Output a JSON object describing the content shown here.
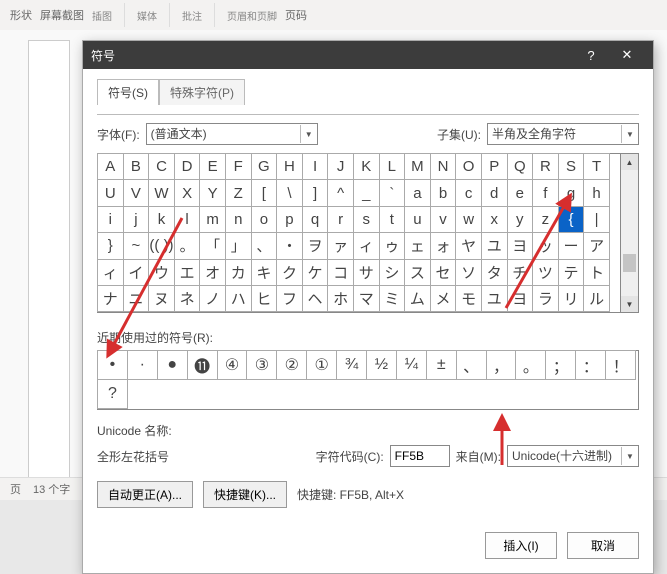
{
  "ribbon": {
    "shapes": "形状",
    "screenshot": "屏幕截图",
    "media": "媒体",
    "comment": "批注",
    "header": "页眉和页脚",
    "pagenum": "页码",
    "insert_group": "插图"
  },
  "status": {
    "page": "页",
    "words": "13 个字"
  },
  "dialog": {
    "title": "符号",
    "tab_symbols": "符号(S)",
    "tab_special": "特殊字符(P)",
    "font_label": "字体(F):",
    "font_value": "(普通文本)",
    "subset_label": "子集(U):",
    "subset_value": "半角及全角字符",
    "grid": [
      [
        "A",
        "B",
        "C",
        "D",
        "E",
        "F",
        "G",
        "H",
        "I",
        "J",
        "K",
        "L",
        "M",
        "N",
        "O",
        "P",
        "Q",
        "R",
        "S",
        "T"
      ],
      [
        "U",
        "V",
        "W",
        "X",
        "Y",
        "Z",
        "[",
        "\\",
        "]",
        "^",
        "_",
        "`",
        "a",
        "b",
        "c",
        "d",
        "e",
        "f",
        "g",
        "h"
      ],
      [
        "i",
        "j",
        "k",
        "l",
        "m",
        "n",
        "o",
        "p",
        "q",
        "r",
        "s",
        "t",
        "u",
        "v",
        "w",
        "x",
        "y",
        "z",
        "{",
        "|"
      ],
      [
        "}",
        "~",
        "(( ))",
        "。",
        "「",
        "」",
        "、",
        "・",
        "ヲ",
        "ァ",
        "ィ",
        "ゥ",
        "ェ",
        "ォ",
        "ヤ",
        "ユ",
        "ヨ",
        "ッ",
        "ー",
        "ア"
      ],
      [
        "ィ",
        "イ",
        "ウ",
        "エ",
        "オ",
        "カ",
        "キ",
        "ク",
        "ケ",
        "コ",
        "サ",
        "シ",
        "ス",
        "セ",
        "ソ",
        "タ",
        "チ",
        "ツ",
        "テ",
        "ト"
      ],
      [
        "ナ",
        "ニ",
        "ヌ",
        "ネ",
        "ノ",
        "ハ",
        "ヒ",
        "フ",
        "ヘ",
        "ホ",
        "マ",
        "ミ",
        "ム",
        "メ",
        "モ",
        "ユ",
        "ヨ",
        "ラ",
        "リ",
        "ル"
      ]
    ],
    "selected": [
      2,
      18
    ],
    "recent_label": "近期使用过的符号(R):",
    "recent": [
      "•",
      "·",
      "●",
      "⓫",
      "④",
      "③",
      "②",
      "①",
      "¾",
      "½",
      "¼",
      "±",
      "、",
      "，",
      "。",
      "；",
      "：",
      "！",
      "?"
    ],
    "unicode_name_label": "Unicode 名称:",
    "unicode_name": "全形左花括号",
    "charcode_label": "字符代码(C):",
    "charcode": "FF5B",
    "from_label": "来自(M):",
    "from_value": "Unicode(十六进制)",
    "autocorrect": "自动更正(A)...",
    "shortcutkey": "快捷键(K)...",
    "shortcut_info": "快捷键: FF5B, Alt+X",
    "insert": "插入(I)",
    "cancel": "取消"
  }
}
